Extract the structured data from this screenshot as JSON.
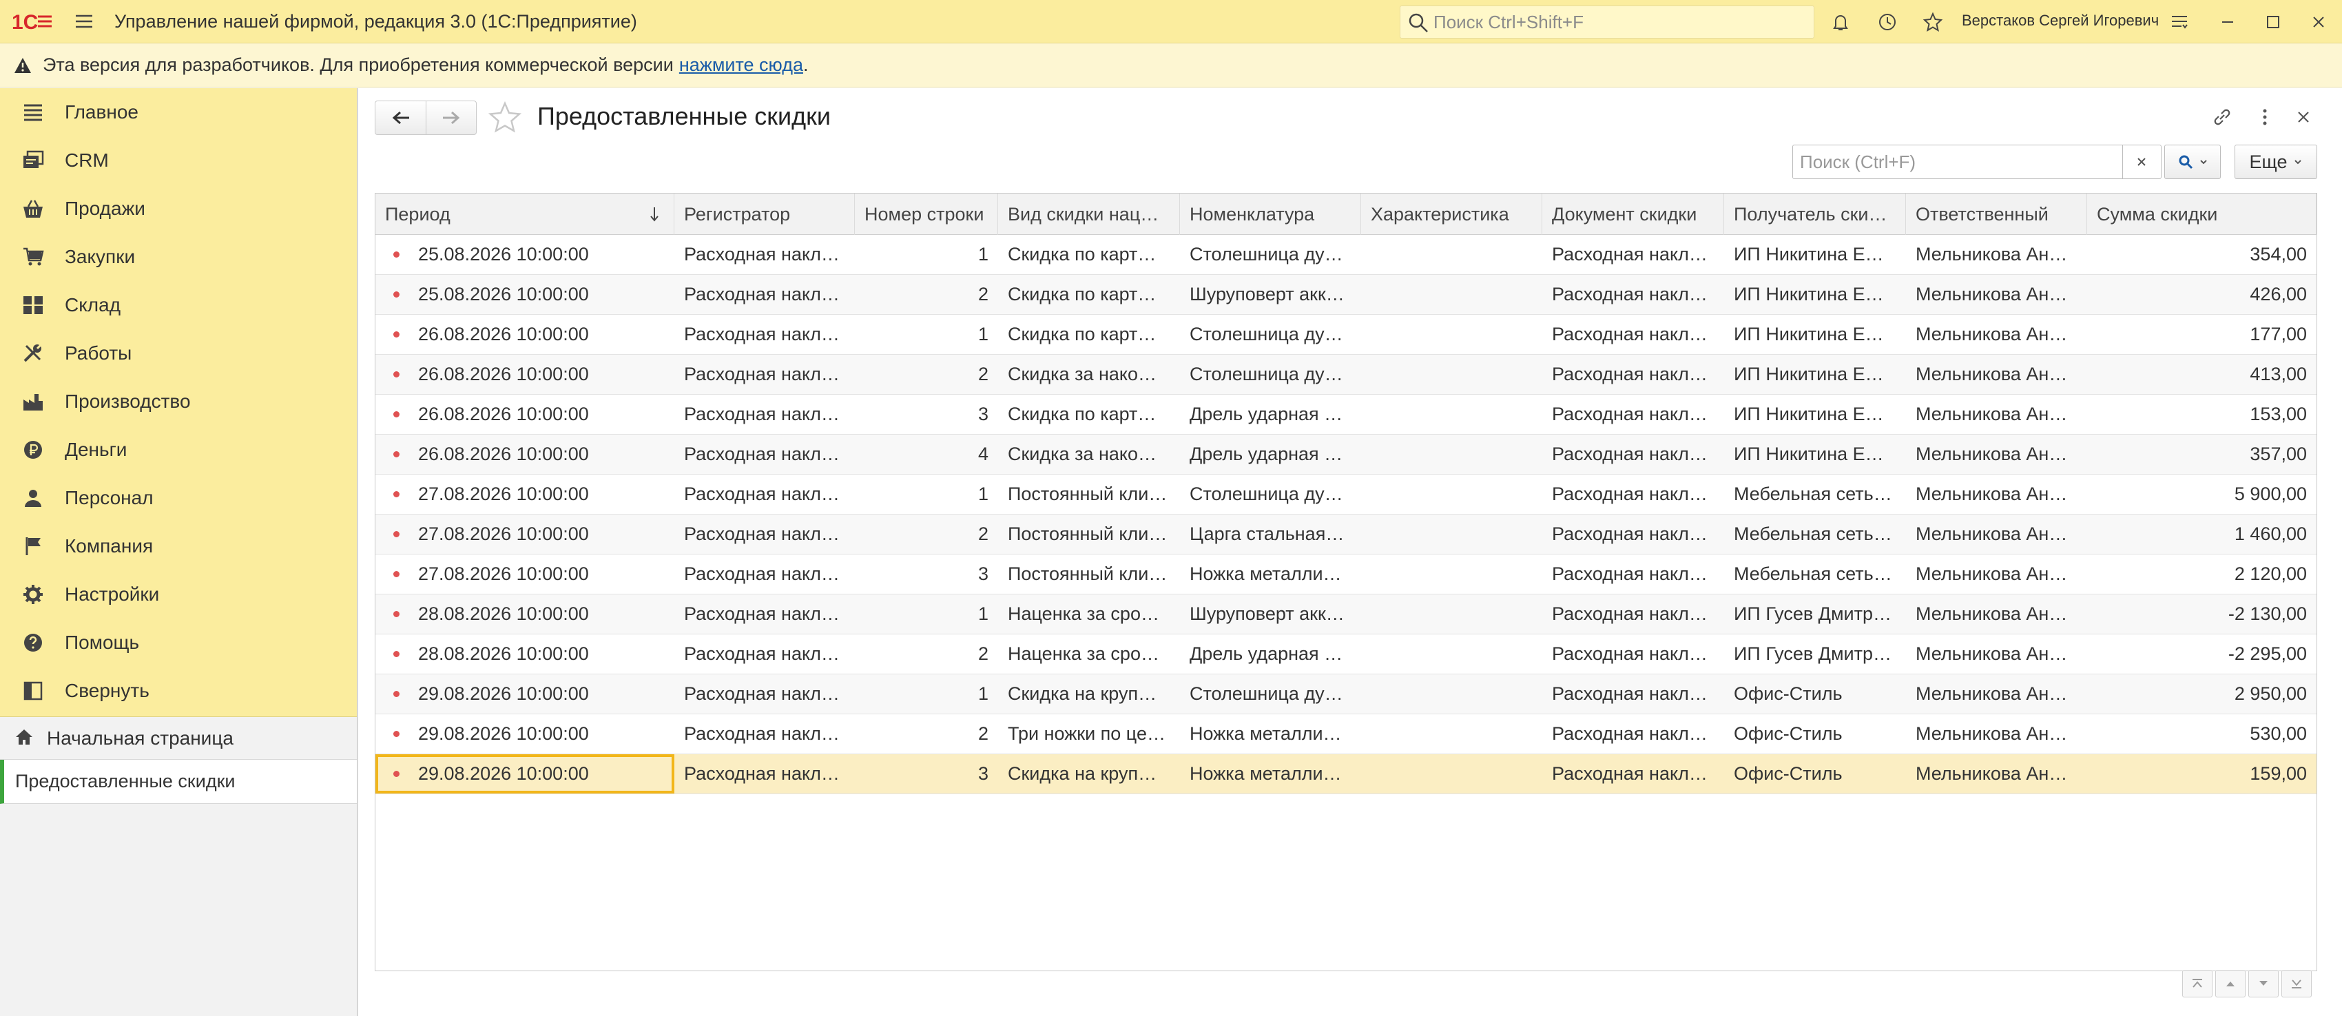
{
  "titlebar": {
    "app_title": "Управление нашей фирмой, редакция 3.0  (1С:Предприятие)",
    "search_placeholder": "Поиск Ctrl+Shift+F",
    "user_name": "Верстаков Сергей Игоревич"
  },
  "banner": {
    "text": "Эта версия для разработчиков. Для приобретения коммерческой версии",
    "link": "нажмите сюда",
    "tail": "."
  },
  "sidebar": {
    "items": [
      {
        "label": "Главное",
        "icon": "list-icon"
      },
      {
        "label": "CRM",
        "icon": "crm-icon"
      },
      {
        "label": "Продажи",
        "icon": "basket-icon"
      },
      {
        "label": "Закупки",
        "icon": "cart-icon"
      },
      {
        "label": "Склад",
        "icon": "warehouse-icon"
      },
      {
        "label": "Работы",
        "icon": "tools-icon"
      },
      {
        "label": "Производство",
        "icon": "factory-icon"
      },
      {
        "label": "Деньги",
        "icon": "ruble-icon"
      },
      {
        "label": "Персонал",
        "icon": "person-icon"
      },
      {
        "label": "Компания",
        "icon": "flag-icon"
      },
      {
        "label": "Настройки",
        "icon": "gear-icon"
      },
      {
        "label": "Помощь",
        "icon": "help-icon"
      },
      {
        "label": "Свернуть",
        "icon": "collapse-icon"
      }
    ],
    "home": "Начальная страница",
    "open_form": "Предоставленные скидки"
  },
  "form": {
    "title": "Предоставленные скидки",
    "search_placeholder": "Поиск (Ctrl+F)",
    "more_label": "Еще"
  },
  "table": {
    "columns": [
      "Период",
      "Регистратор",
      "Номер строки",
      "Вид скидки нац…",
      "Номенклатура",
      "Характеристика",
      "Документ скидки",
      "Получатель ски…",
      "Ответственный",
      "Сумма скидки"
    ],
    "rows": [
      [
        "25.08.2026 10:00:00",
        "Расходная накл…",
        "1",
        "Скидка по карт…",
        "Столешница ду…",
        "",
        "Расходная накл…",
        "ИП Никитина Е…",
        "Мельникова Ан…",
        "354,00"
      ],
      [
        "25.08.2026 10:00:00",
        "Расходная накл…",
        "2",
        "Скидка по карт…",
        "Шуруповерт акк…",
        "",
        "Расходная накл…",
        "ИП Никитина Е…",
        "Мельникова Ан…",
        "426,00"
      ],
      [
        "26.08.2026 10:00:00",
        "Расходная накл…",
        "1",
        "Скидка по карт…",
        "Столешница ду…",
        "",
        "Расходная накл…",
        "ИП Никитина Е…",
        "Мельникова Ан…",
        "177,00"
      ],
      [
        "26.08.2026 10:00:00",
        "Расходная накл…",
        "2",
        "Скидка за нако…",
        "Столешница ду…",
        "",
        "Расходная накл…",
        "ИП Никитина Е…",
        "Мельникова Ан…",
        "413,00"
      ],
      [
        "26.08.2026 10:00:00",
        "Расходная накл…",
        "3",
        "Скидка по карт…",
        "Дрель ударная …",
        "",
        "Расходная накл…",
        "ИП Никитина Е…",
        "Мельникова Ан…",
        "153,00"
      ],
      [
        "26.08.2026 10:00:00",
        "Расходная накл…",
        "4",
        "Скидка за нако…",
        "Дрель ударная …",
        "",
        "Расходная накл…",
        "ИП Никитина Е…",
        "Мельникова Ан…",
        "357,00"
      ],
      [
        "27.08.2026 10:00:00",
        "Расходная накл…",
        "1",
        "Постоянный кли…",
        "Столешница ду…",
        "",
        "Расходная накл…",
        "Мебельная сеть…",
        "Мельникова Ан…",
        "5 900,00"
      ],
      [
        "27.08.2026 10:00:00",
        "Расходная накл…",
        "2",
        "Постоянный кли…",
        "Царга стальная…",
        "",
        "Расходная накл…",
        "Мебельная сеть…",
        "Мельникова Ан…",
        "1 460,00"
      ],
      [
        "27.08.2026 10:00:00",
        "Расходная накл…",
        "3",
        "Постоянный кли…",
        "Ножка металли…",
        "",
        "Расходная накл…",
        "Мебельная сеть…",
        "Мельникова Ан…",
        "2 120,00"
      ],
      [
        "28.08.2026 10:00:00",
        "Расходная накл…",
        "1",
        "Наценка за сро…",
        "Шуруповерт акк…",
        "",
        "Расходная накл…",
        "ИП Гусев Дмитр…",
        "Мельникова Ан…",
        "-2 130,00"
      ],
      [
        "28.08.2026 10:00:00",
        "Расходная накл…",
        "2",
        "Наценка за сро…",
        "Дрель ударная …",
        "",
        "Расходная накл…",
        "ИП Гусев Дмитр…",
        "Мельникова Ан…",
        "-2 295,00"
      ],
      [
        "29.08.2026 10:00:00",
        "Расходная накл…",
        "1",
        "Скидка на круп…",
        "Столешница ду…",
        "",
        "Расходная накл…",
        "Офис-Стиль",
        "Мельникова Ан…",
        "2 950,00"
      ],
      [
        "29.08.2026 10:00:00",
        "Расходная накл…",
        "2",
        "Три ножки по це…",
        "Ножка металли…",
        "",
        "Расходная накл…",
        "Офис-Стиль",
        "Мельникова Ан…",
        "530,00"
      ],
      [
        "29.08.2026 10:00:00",
        "Расходная накл…",
        "3",
        "Скидка на круп…",
        "Ножка металли…",
        "",
        "Расходная накл…",
        "Офис-Стиль",
        "Мельникова Ан…",
        "159,00"
      ]
    ],
    "selected_row": 13
  },
  "colors": {
    "accent_yellow": "#fbed9e",
    "selection": "#fbeec3",
    "selection_border": "#f2b619",
    "record_dot": "#e05252",
    "logo_red": "#d7272b"
  }
}
